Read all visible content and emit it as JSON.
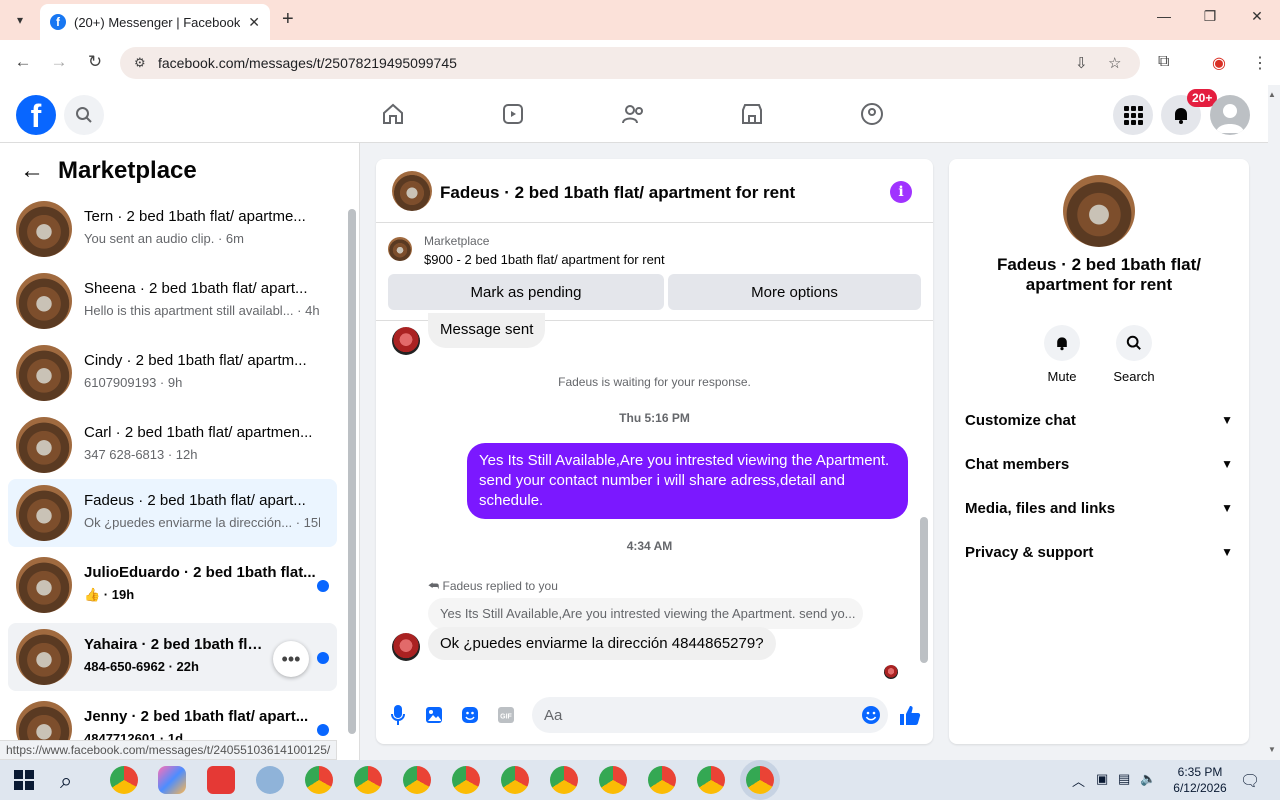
{
  "browser": {
    "tab_title": "(20+) Messenger | Facebook",
    "url": "facebook.com/messages/t/25078219495099745",
    "status_url": "https://www.facebook.com/messages/t/24055103614100125/"
  },
  "fb_header": {
    "notifications_badge": "20+"
  },
  "left": {
    "title": "Marketplace",
    "conversations": [
      {
        "name": "Tern · 2 bed 1bath flat/ apartme...",
        "preview": "You sent an audio clip. · 6m",
        "unread": false
      },
      {
        "name": "Sheena · 2 bed 1bath flat/ apart...",
        "preview": "Hello is this apartment still availabl... · 4h",
        "unread": false
      },
      {
        "name": "Cindy · 2 bed 1bath flat/ apartm...",
        "preview": "6107909193 · 9h",
        "unread": false
      },
      {
        "name": "Carl · 2 bed 1bath flat/ apartmen...",
        "preview": "347 628-6813 · 12h",
        "unread": false
      },
      {
        "name": "Fadeus · 2 bed 1bath flat/ apart...",
        "preview": "Ok ¿puedes enviarme la dirección... · 15h",
        "unread": false,
        "active": true
      },
      {
        "name": "JulioEduardo · 2 bed 1bath flat...",
        "preview": "👍 · 19h",
        "unread": true
      },
      {
        "name": "Yahaira · 2 bed 1bath flat/ ap...",
        "preview": "484-650-6962 · 22h",
        "unread": true
      },
      {
        "name": "Jenny · 2 bed 1bath flat/ apart...",
        "preview": "4847712601 · 1d",
        "unread": true
      }
    ]
  },
  "chat": {
    "title": "Fadeus · 2 bed 1bath flat/ apartment for rent",
    "marketplace_label": "Marketplace",
    "listing": "$900 - 2 bed 1bath flat/ apartment for rent",
    "mark_pending": "Mark as pending",
    "more_options": "More options",
    "msg_sent": "Message sent",
    "waiting": "Fadeus is waiting for your response.",
    "time1": "Thu 5:16 PM",
    "outgoing": "Yes Its Still Available,Are you intrested viewing the Apartment. send your contact number i will share adress,detail and schedule.",
    "time2": "4:34 AM",
    "replied_note": "Fadeus replied to you",
    "quoted": "Yes Its Still Available,Are you intrested viewing the Apartment. send yo...",
    "incoming": "Ok ¿puedes enviarme la dirección 4844865279?",
    "placeholder": "Aa"
  },
  "right": {
    "title": "Fadeus · 2 bed 1bath flat/ apartment for rent",
    "mute": "Mute",
    "search": "Search",
    "sections": [
      "Customize chat",
      "Chat members",
      "Media, files and links",
      "Privacy & support"
    ]
  },
  "taskbar": {
    "time": "6:35 PM",
    "date": "6/12/2026"
  },
  "colors": {
    "accent_purple": "#7b18ff",
    "fb_blue": "#0866ff",
    "badge_red": "#e41e3f"
  }
}
